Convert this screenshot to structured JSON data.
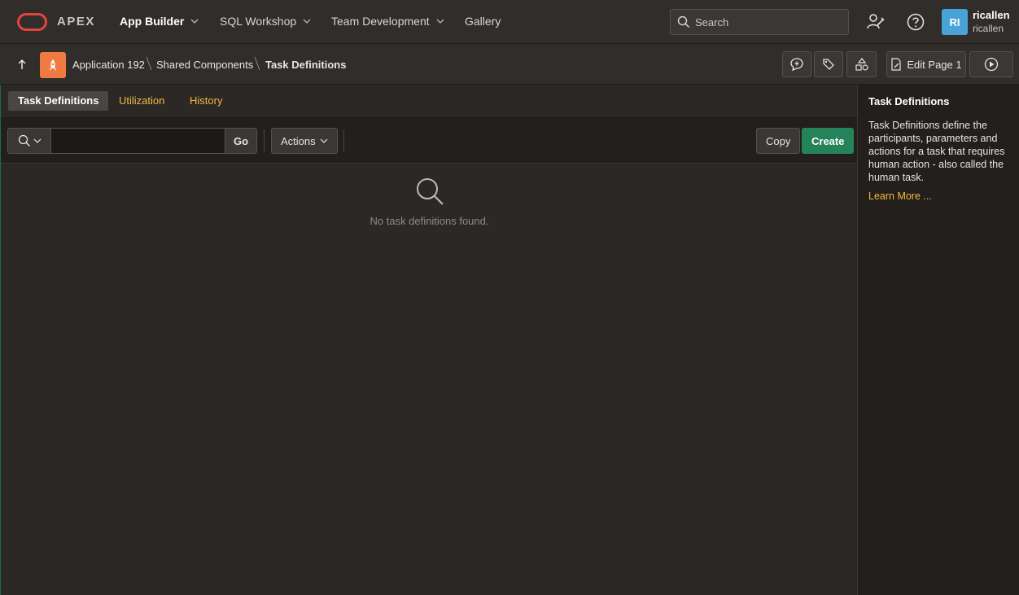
{
  "header": {
    "brand": "APEX",
    "nav": [
      {
        "label": "App Builder",
        "has_menu": true
      },
      {
        "label": "SQL Workshop",
        "has_menu": true
      },
      {
        "label": "Team Development",
        "has_menu": true
      },
      {
        "label": "Gallery",
        "has_menu": false
      }
    ],
    "search_placeholder": "Search",
    "user": {
      "initials": "RI",
      "name": "ricallen",
      "workspace": "ricallen"
    },
    "colors": {
      "brand_ring": "#e0463a",
      "avatar": "#4aa3d6"
    }
  },
  "breadcrumb": {
    "items": [
      "Application 192",
      "Shared Components",
      "Task Definitions"
    ],
    "edit_page_label": "Edit Page 1",
    "tools": [
      "new-comment-icon",
      "bug-icon",
      "shapes-icon"
    ]
  },
  "tabs": [
    {
      "label": "Task Definitions",
      "active": true
    },
    {
      "label": "Utilization",
      "active": false
    },
    {
      "label": "History",
      "active": false
    }
  ],
  "toolbar": {
    "search_value": "",
    "go_label": "Go",
    "actions_label": "Actions",
    "copy_label": "Copy",
    "create_label": "Create"
  },
  "report": {
    "empty_message": "No task definitions found."
  },
  "help": {
    "title": "Task Definitions",
    "body": "Task Definitions define the participants, parameters and actions for a task that requires human action - also called the human task.",
    "link": "Learn More ..."
  }
}
